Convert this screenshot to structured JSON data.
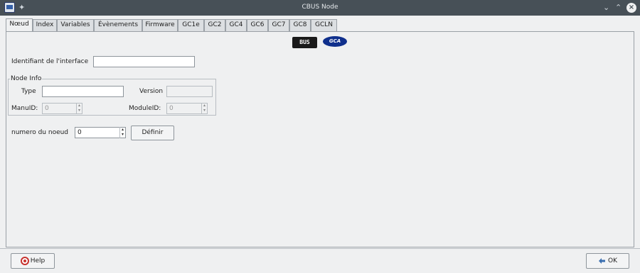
{
  "window": {
    "title": "CBUS Node"
  },
  "tabs": [
    "Nœud",
    "Index",
    "Variables",
    "Évènements",
    "Firmware",
    "GC1e",
    "GC2",
    "GC4",
    "GC6",
    "GC7",
    "GC8",
    "GCLN"
  ],
  "logos": {
    "cbus": "BUS",
    "gca": "GCA"
  },
  "form": {
    "interface_label": "Identifiant de l'interface",
    "interface_value": "",
    "group_title": "Node Info",
    "type_label": "Type",
    "type_value": "",
    "version_label": "Version",
    "version_value": "",
    "manuid_label": "ManuID:",
    "manuid_value": "0",
    "moduleid_label": "ModuleID:",
    "moduleid_value": "0",
    "node_number_label": "numero du noeud",
    "node_number_value": "0",
    "define_button": "Définir"
  },
  "footer": {
    "help_button": "Help",
    "ok_button": "OK"
  }
}
